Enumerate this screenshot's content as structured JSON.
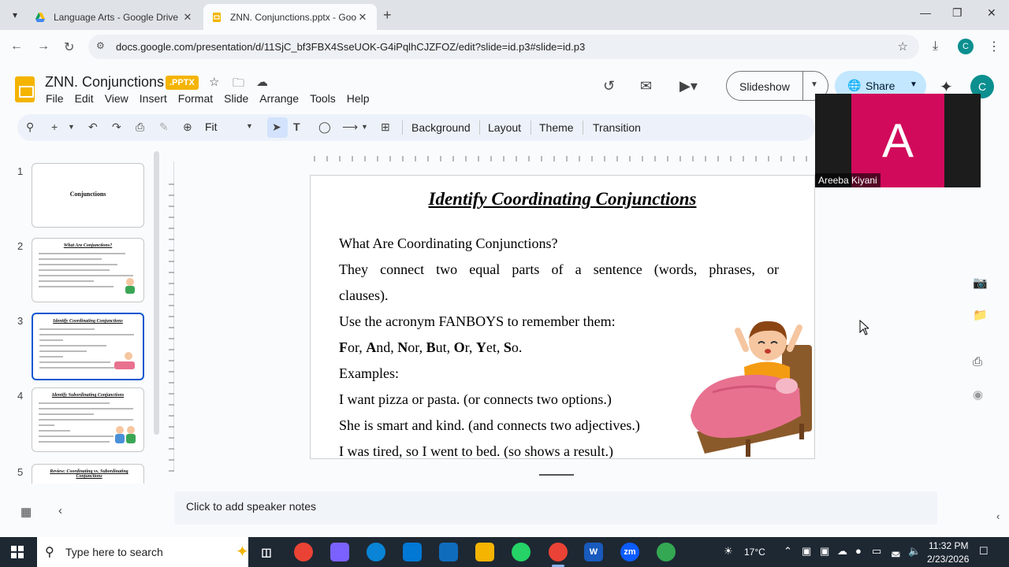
{
  "browser": {
    "tabs": [
      {
        "title": "Language Arts - Google Drive",
        "active": false,
        "favicon": "google-drive-icon"
      },
      {
        "title": "ZNN. Conjunctions.pptx - Goog",
        "active": true,
        "favicon": "google-slides-icon"
      }
    ],
    "url": "docs.google.com/presentation/d/11SjC_bf3FBX4SseUOK-G4iPqlhCJZFOZ/edit?slide=id.p3#slide=id.p3",
    "profile_initial": "C"
  },
  "app": {
    "doc_title": "ZNN. Conjunctions",
    "file_badge": ".PPTX",
    "menu": [
      "File",
      "Edit",
      "View",
      "Insert",
      "Format",
      "Slide",
      "Arrange",
      "Tools",
      "Help"
    ],
    "slideshow_label": "Slideshow",
    "share_label": "Share",
    "account_initial": "C",
    "accent_color": "#f4b400",
    "share_bg": "#c2e7ff"
  },
  "toolbar": {
    "zoom_value": "Fit",
    "buttons": [
      "Background",
      "Layout",
      "Theme",
      "Transition"
    ]
  },
  "filmstrip": {
    "slides": [
      {
        "num": "1",
        "title": "Conjunctions"
      },
      {
        "num": "2",
        "title": "What Are Conjunctions?"
      },
      {
        "num": "3",
        "title": "Identify Coordinating Conjunctions"
      },
      {
        "num": "4",
        "title": "Identify Subordinating Conjunctions"
      },
      {
        "num": "5",
        "title": "Review: Coordinating vs. Subordinating Conjunctions"
      }
    ],
    "selected": "3"
  },
  "slide": {
    "title": "Identify Coordinating Conjunctions",
    "line1": "What Are Coordinating Conjunctions?",
    "line2": "They connect two equal parts of a sentence (words, phrases, or",
    "line3": "clauses).",
    "line4": "Use the acronym FANBOYS to remember them:",
    "fanboys": [
      {
        "cap": "F",
        "rest": "or"
      },
      {
        "cap": "A",
        "rest": "nd"
      },
      {
        "cap": "N",
        "rest": "or"
      },
      {
        "cap": "B",
        "rest": "ut"
      },
      {
        "cap": "O",
        "rest": "r"
      },
      {
        "cap": "Y",
        "rest": "et"
      },
      {
        "cap": "S",
        "rest": "o"
      }
    ],
    "examples_label": "Examples:",
    "example1": "I want pizza or pasta. (or connects two options.)",
    "example2": "She is smart and kind. (and connects two adjectives.)",
    "example3": "I was tired, so I went to bed. (so shows a result.)"
  },
  "notes_placeholder": "Click to add speaker notes",
  "meeting": {
    "participant_initial": "A",
    "participant_name": "Areeba Kiyani",
    "avatar_color": "#d10a5b"
  },
  "taskbar": {
    "search_placeholder": "Type here to search",
    "temperature": "17°C",
    "time": "11:32 PM",
    "date": "2/23/2026"
  }
}
